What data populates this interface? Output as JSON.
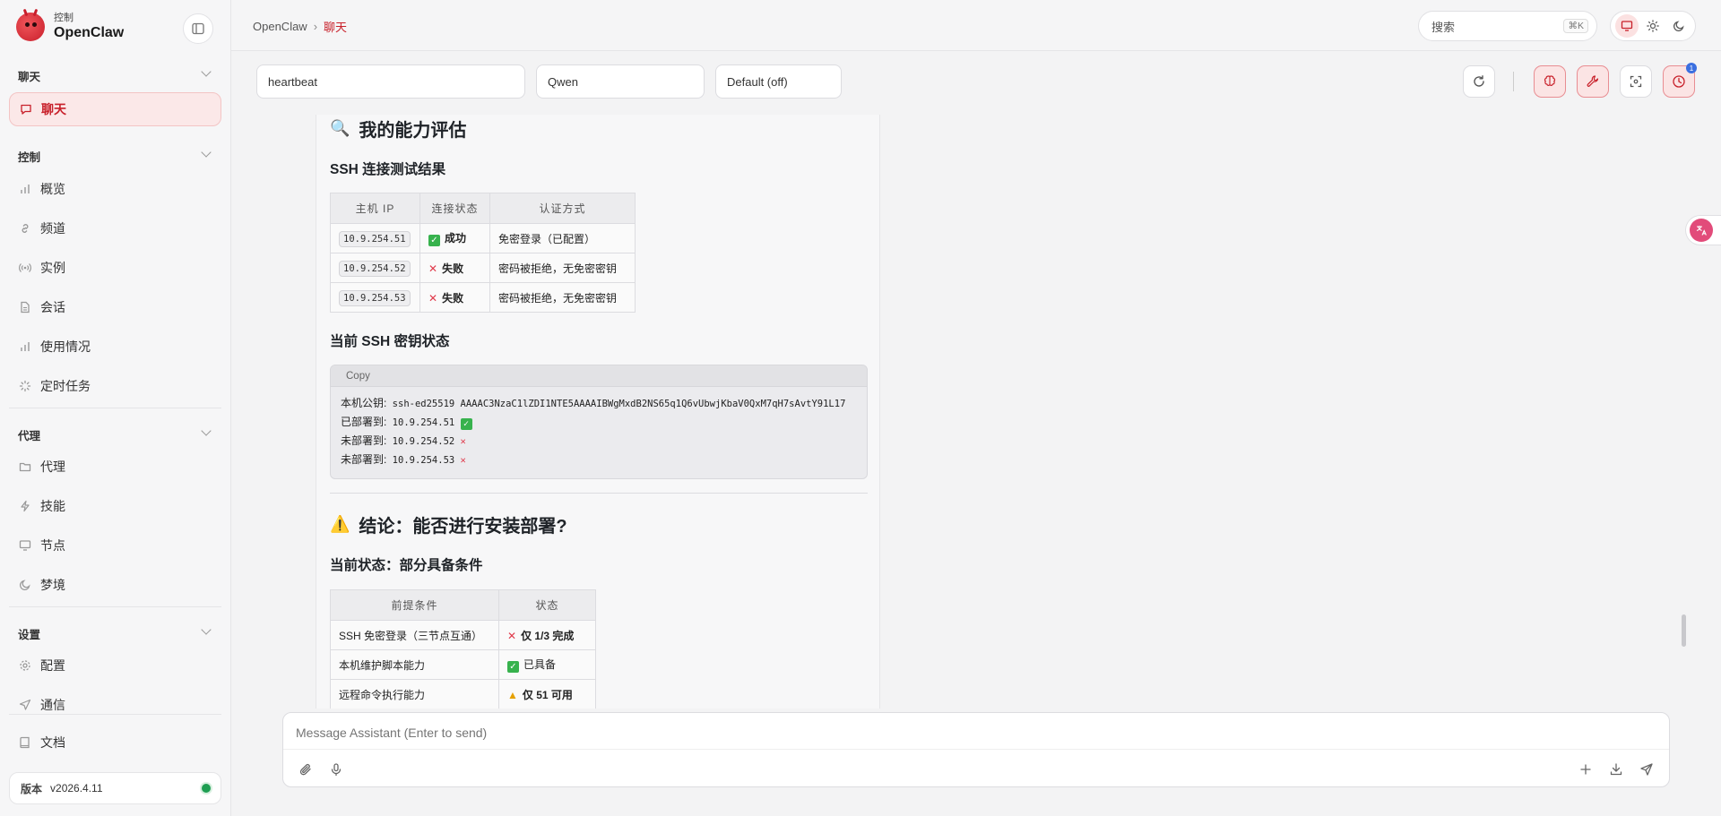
{
  "brand": {
    "sub": "控制",
    "name": "OpenClaw"
  },
  "sidebar": {
    "groups": [
      {
        "title": "聊天"
      },
      {
        "title": "控制"
      },
      {
        "title": "代理"
      },
      {
        "title": "设置"
      }
    ],
    "active_item": "聊天",
    "items": [
      "概览",
      "频道",
      "实例",
      "会话",
      "使用情况",
      "定时任务",
      "代理",
      "技能",
      "节点",
      "梦境",
      "配置",
      "通信",
      "文档"
    ],
    "version_label": "版本",
    "version_value": "v2026.4.11"
  },
  "topbar": {
    "breadcrumb_root": "OpenClaw",
    "breadcrumb_sep": "›",
    "breadcrumb_current": "聊天",
    "search_placeholder": "搜索",
    "search_shortcut": "⌘K"
  },
  "controls": {
    "session": "heartbeat",
    "model": "Qwen",
    "thinking": "Default (off)",
    "badge_count": "1"
  },
  "chat": {
    "heading_eval": "我的能力评估",
    "heading_eval_emoji": "🔍",
    "ssh_test_title": "SSH 连接测试结果",
    "ssh_table": {
      "headers": [
        "主机 IP",
        "连接状态",
        "认证方式"
      ],
      "rows": [
        {
          "ip": "10.9.254.51",
          "status": "成功",
          "auth": "免密登录（已配置）"
        },
        {
          "ip": "10.9.254.52",
          "status": "失败",
          "auth": "密码被拒绝，无免密密钥"
        },
        {
          "ip": "10.9.254.53",
          "status": "失败",
          "auth": "密码被拒绝，无免密密钥"
        }
      ]
    },
    "key_status_title": "当前 SSH 密钥状态",
    "code": {
      "copy_label": "Copy",
      "line1_label": "本机公钥:",
      "line1_value": "ssh-ed25519 AAAAC3NzaC1lZDI1NTE5AAAAIBWgMxdB2NS65q1Q6vUbwjKbaV0QxM7qH7sAvtY91L17",
      "line2_label": "已部署到:",
      "line2_value": "10.9.254.51",
      "line3_label": "未部署到:",
      "line3_value": "10.9.254.52",
      "line4_label": "未部署到:",
      "line4_value": "10.9.254.53"
    },
    "heading_conclusion": "结论：能否进行安装部署?",
    "heading_conclusion_emoji": "⚠️",
    "current_state_title": "当前状态：部分具备条件",
    "req_table": {
      "headers": [
        "前提条件",
        "状态"
      ],
      "rows": [
        {
          "cond": "SSH 免密登录（三节点互通）",
          "status": "仅 1/3 完成",
          "kind": "bad"
        },
        {
          "cond": "本机维护脚本能力",
          "status": "已具备",
          "kind": "ok"
        },
        {
          "cond": "远程命令执行能力",
          "status": "仅 51 可用",
          "kind": "warn"
        }
      ]
    }
  },
  "composer": {
    "placeholder": "Message Assistant (Enter to send)"
  },
  "colors": {
    "accent": "#c8202a",
    "accent_bg": "#fbe8e8",
    "ok": "#37b24d",
    "bad": "#e03a4b",
    "online": "#1e9e52"
  }
}
